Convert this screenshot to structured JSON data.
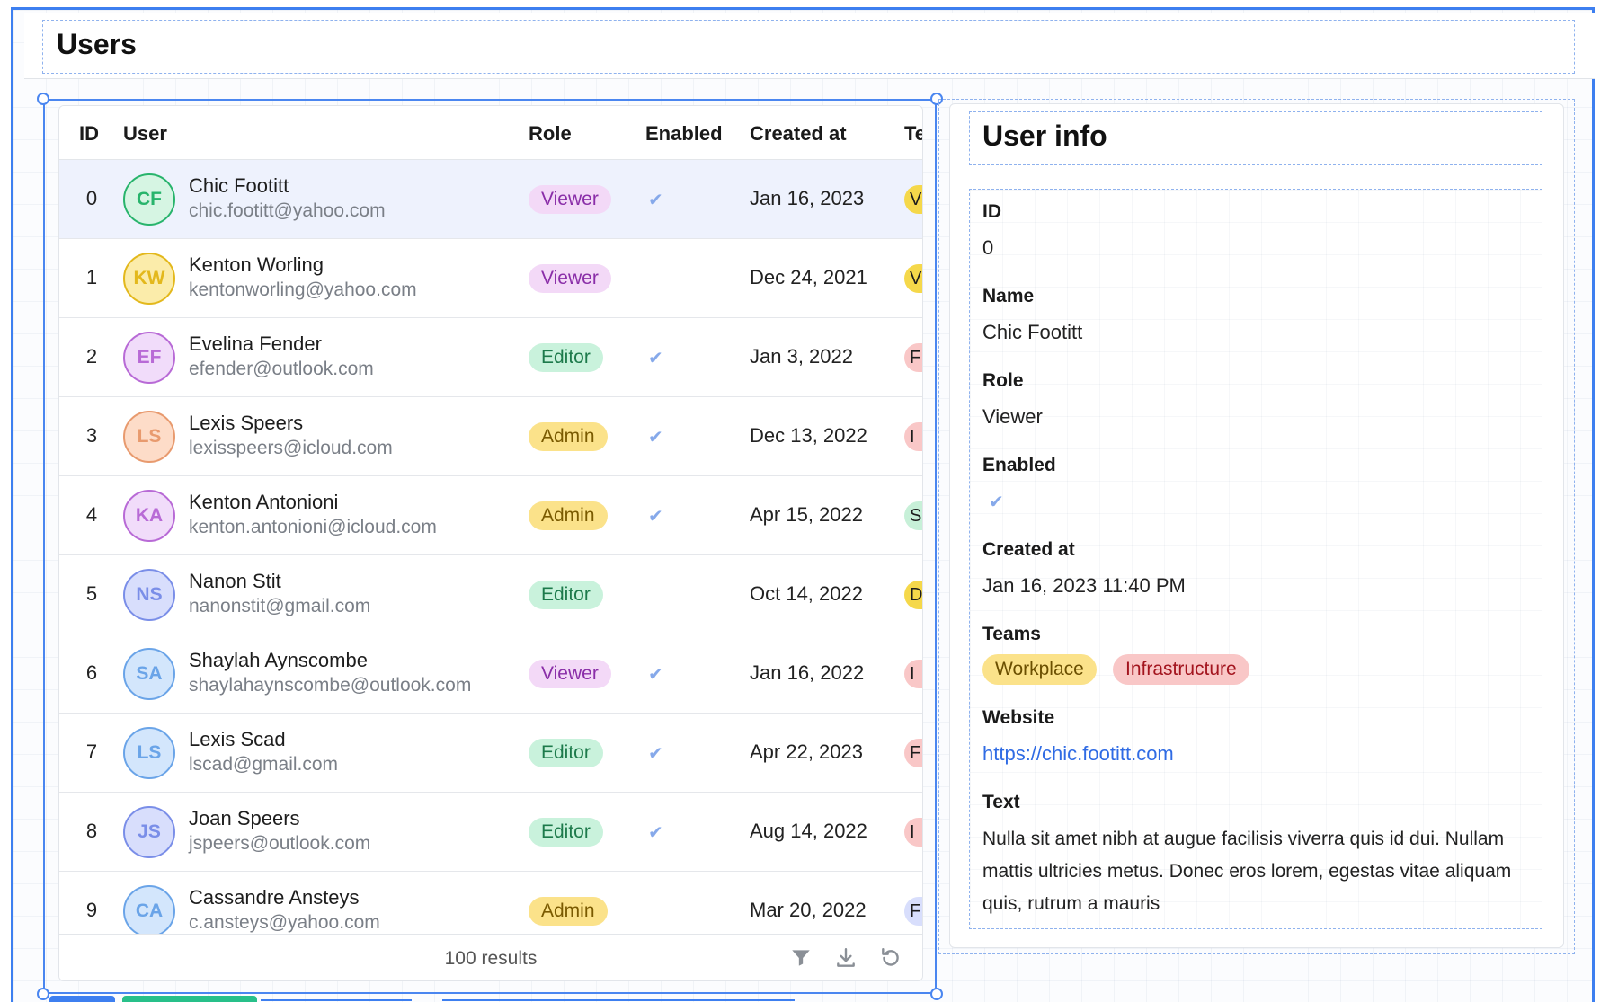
{
  "page": {
    "title": "Users"
  },
  "table": {
    "columns": [
      "ID",
      "User",
      "Role",
      "Enabled",
      "Created at",
      "Te"
    ],
    "rows": [
      {
        "id": "0",
        "initials": "CF",
        "name": "Chic Footitt",
        "email": "chic.footitt@yahoo.com",
        "role": "Viewer",
        "enabled": true,
        "created": "Jan 16, 2023",
        "team_peek": "V",
        "avatar_color": "#28b46c",
        "avatar_bg": "#d6f5e3",
        "team_color": "#f5d84a"
      },
      {
        "id": "1",
        "initials": "KW",
        "name": "Kenton Worling",
        "email": "kentonworling@yahoo.com",
        "role": "Viewer",
        "enabled": false,
        "created": "Dec 24, 2021",
        "team_peek": "V",
        "avatar_color": "#e3b81c",
        "avatar_bg": "#fbecaa",
        "team_color": "#f5d84a"
      },
      {
        "id": "2",
        "initials": "EF",
        "name": "Evelina Fender",
        "email": "efender@outlook.com",
        "role": "Editor",
        "enabled": true,
        "created": "Jan 3, 2022",
        "team_peek": "F",
        "avatar_color": "#b86ad6",
        "avatar_bg": "#f1dcfa",
        "team_color": "#f9c7c7"
      },
      {
        "id": "3",
        "initials": "LS",
        "name": "Lexis Speers",
        "email": "lexisspeers@icloud.com",
        "role": "Admin",
        "enabled": true,
        "created": "Dec 13, 2022",
        "team_peek": "I",
        "avatar_color": "#e89a6e",
        "avatar_bg": "#fddcc8",
        "team_color": "#f9c7c7"
      },
      {
        "id": "4",
        "initials": "KA",
        "name": "Kenton Antonioni",
        "email": "kenton.antonioni@icloud.com",
        "role": "Admin",
        "enabled": true,
        "created": "Apr 15, 2022",
        "team_peek": "S",
        "avatar_color": "#b86ad6",
        "avatar_bg": "#f1dcfa",
        "team_color": "#c7f0d8"
      },
      {
        "id": "5",
        "initials": "NS",
        "name": "Nanon Stit",
        "email": "nanonstit@gmail.com",
        "role": "Editor",
        "enabled": false,
        "created": "Oct 14, 2022",
        "team_peek": "D",
        "avatar_color": "#7a8ee8",
        "avatar_bg": "#d8defc",
        "team_color": "#f5d84a"
      },
      {
        "id": "6",
        "initials": "SA",
        "name": "Shaylah Aynscombe",
        "email": "shaylahaynscombe@outlook.com",
        "role": "Viewer",
        "enabled": true,
        "created": "Jan 16, 2022",
        "team_peek": "I",
        "avatar_color": "#6aa4e8",
        "avatar_bg": "#d3e6fc",
        "team_color": "#f9c7c7"
      },
      {
        "id": "7",
        "initials": "LS",
        "name": "Lexis Scad",
        "email": "lscad@gmail.com",
        "role": "Editor",
        "enabled": true,
        "created": "Apr 22, 2023",
        "team_peek": "F",
        "avatar_color": "#6aa4e8",
        "avatar_bg": "#d3e6fc",
        "team_color": "#f9c7c7"
      },
      {
        "id": "8",
        "initials": "JS",
        "name": "Joan Speers",
        "email": "jspeers@outlook.com",
        "role": "Editor",
        "enabled": true,
        "created": "Aug 14, 2022",
        "team_peek": "I",
        "avatar_color": "#7a8ee8",
        "avatar_bg": "#d8defc",
        "team_color": "#f9c7c7"
      },
      {
        "id": "9",
        "initials": "CA",
        "name": "Cassandre Ansteys",
        "email": "c.ansteys@yahoo.com",
        "role": "Admin",
        "enabled": false,
        "created": "Mar 20, 2022",
        "team_peek": "F",
        "avatar_color": "#6aa4e8",
        "avatar_bg": "#d3e6fc",
        "team_color": "#d8defc"
      }
    ],
    "footer": {
      "results": "100 results"
    },
    "icons": [
      "filter-icon",
      "download-icon",
      "refresh-icon"
    ]
  },
  "roles": {
    "Viewer": {
      "bg": "#f3d9f7",
      "fg": "#8a2ea8"
    },
    "Editor": {
      "bg": "#c9f2dc",
      "fg": "#1d7a4b"
    },
    "Admin": {
      "bg": "#fbe28a",
      "fg": "#7a5a00"
    }
  },
  "info": {
    "title": "User info",
    "fields": {
      "id_label": "ID",
      "id_value": "0",
      "name_label": "Name",
      "name_value": "Chic Footitt",
      "role_label": "Role",
      "role_value": "Viewer",
      "enabled_label": "Enabled",
      "created_label": "Created at",
      "created_value": "Jan 16, 2023 11:40 PM",
      "teams_label": "Teams",
      "teams": [
        "Workplace",
        "Infrastructure"
      ],
      "website_label": "Website",
      "website_value": "https://chic.footitt.com",
      "text_label": "Text",
      "text_value": "Nulla sit amet nibh at augue facilisis viverra quis id dui. Nullam mattis ultricies metus. Donec eros lorem, egestas vitae aliquam quis, rutrum a mauris"
    }
  },
  "colors": {
    "accent": "#3d7ff0",
    "selected_row": "#eef2fd",
    "link": "#2f6be4"
  }
}
